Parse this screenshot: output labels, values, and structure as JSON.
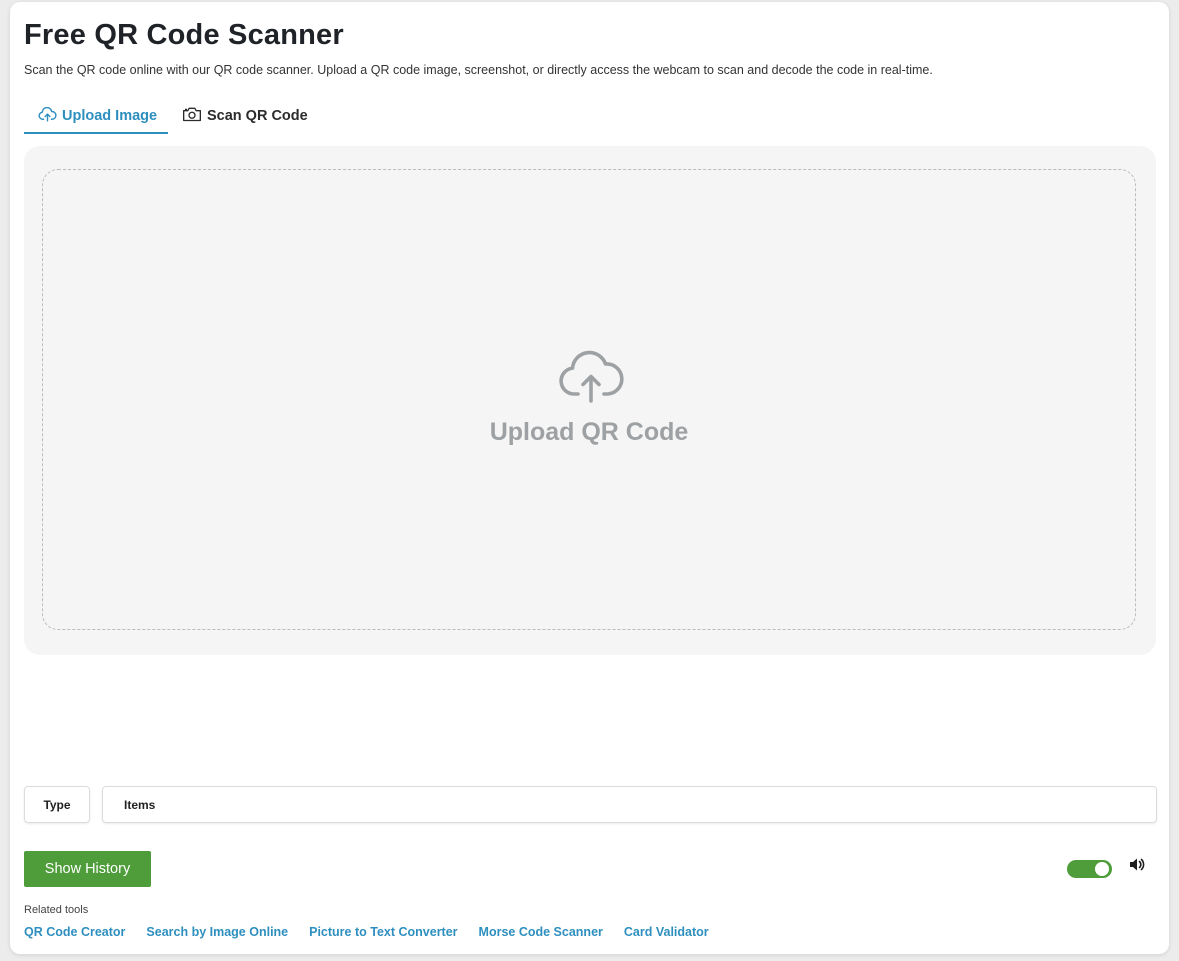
{
  "page": {
    "title": "Free QR Code Scanner",
    "description": "Scan the QR code online with our QR code scanner. Upload a QR code image, screenshot, or directly access the webcam to scan and decode the code in real-time."
  },
  "tabs": [
    {
      "label": "Upload Image",
      "icon": "cloud-upload-icon",
      "active": true
    },
    {
      "label": "Scan QR Code",
      "icon": "camera-icon",
      "active": false
    }
  ],
  "upload": {
    "label": "Upload QR Code",
    "icon": "cloud-upload-icon"
  },
  "results": {
    "type_header": "Type",
    "items_header": "Items"
  },
  "controls": {
    "show_history_label": "Show History",
    "sound_toggle_on": true,
    "sound_icon": "speaker-icon"
  },
  "related": {
    "label": "Related tools",
    "links": [
      "QR Code Creator",
      "Search by Image Online",
      "Picture to Text Converter",
      "Morse Code Scanner",
      "Card Validator"
    ]
  },
  "colors": {
    "accent": "#2e8fbf",
    "button_green": "#4e9d3a",
    "panel_bg": "#f4f5f4",
    "muted_text": "#9ea1a3"
  }
}
